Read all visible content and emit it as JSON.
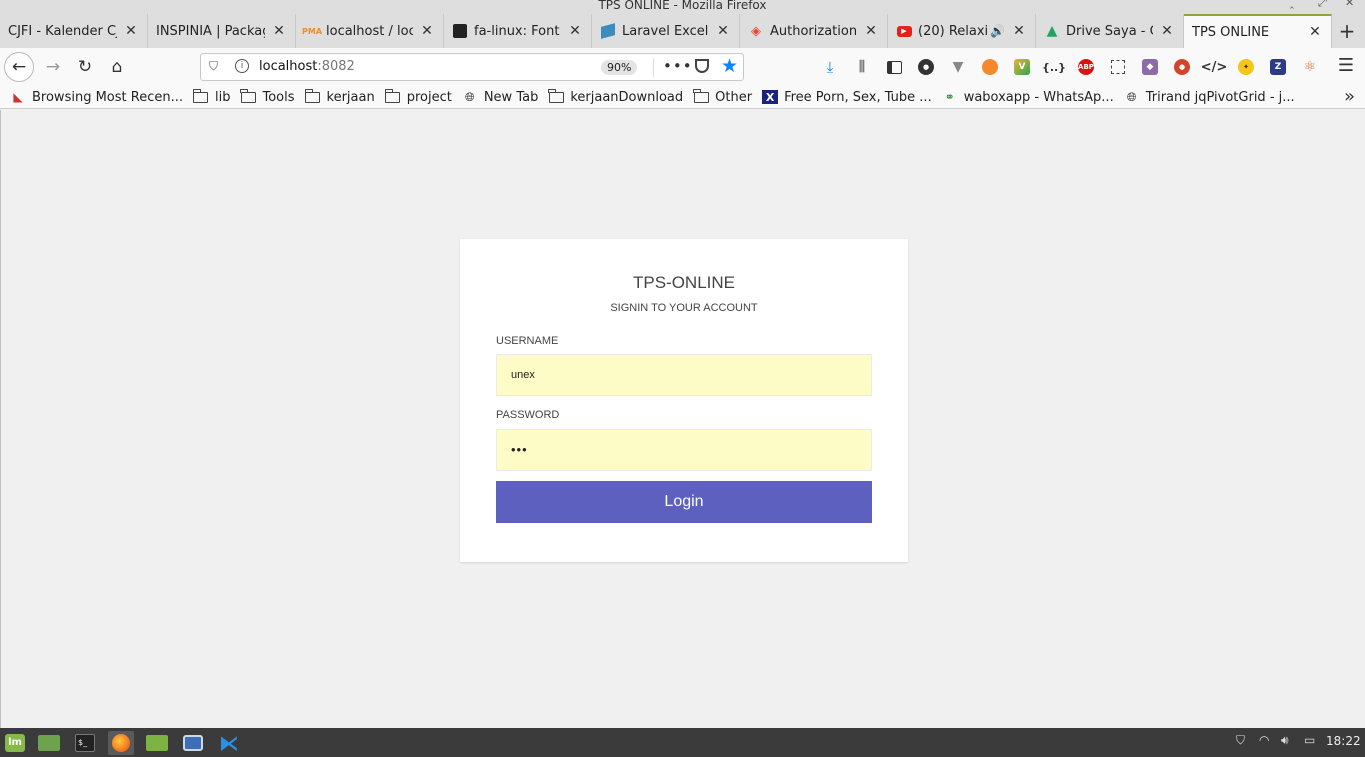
{
  "window": {
    "title": "TPS ONLINE - Mozilla Firefox"
  },
  "tabs": [
    {
      "title": "CJFI - Kalender CJ",
      "icon": "calendar-icon",
      "color": "#d44"
    },
    {
      "title": "INSPINIA | Packag",
      "icon": "",
      "color": ""
    },
    {
      "title": "localhost / loca",
      "icon": "phpmyadmin-icon",
      "color": "#e98d2f"
    },
    {
      "title": "fa-linux: Font A",
      "icon": "fontawesome-icon",
      "color": "#222"
    },
    {
      "title": "Laravel Excel |",
      "icon": "laravel-excel-icon",
      "color": "#3c8dbc"
    },
    {
      "title": "Authorization",
      "icon": "laravel-icon",
      "color": "#e74430"
    },
    {
      "title": "(20) Relaxin",
      "icon": "youtube-icon",
      "color": "#e62117"
    },
    {
      "title": "Drive Saya - Go",
      "icon": "google-drive-icon",
      "color": "#1fa463"
    },
    {
      "title": "TPS ONLINE",
      "icon": "",
      "color": ""
    }
  ],
  "urlbar": {
    "host": "localhost",
    "port": ":8082",
    "zoom": "90%"
  },
  "bookmarks": [
    {
      "label": "Browsing Most Recen...",
      "icon": "recent-icon"
    },
    {
      "label": "lib",
      "icon": "folder-icon"
    },
    {
      "label": "Tools",
      "icon": "folder-icon"
    },
    {
      "label": "kerjaan",
      "icon": "folder-icon"
    },
    {
      "label": "project",
      "icon": "folder-icon"
    },
    {
      "label": "New Tab",
      "icon": "globe-icon"
    },
    {
      "label": "kerjaanDownload",
      "icon": "folder-icon"
    },
    {
      "label": "Other",
      "icon": "folder-icon"
    },
    {
      "label": "Free Porn, Sex, Tube ...",
      "icon": "x-site-icon"
    },
    {
      "label": "waboxapp - WhatsAp...",
      "icon": "waboxapp-icon"
    },
    {
      "label": "Trirand jqPivotGrid - j...",
      "icon": "globe-icon"
    }
  ],
  "login": {
    "title": "TPS-ONLINE",
    "subtitle": "SIGNIN TO YOUR ACCOUNT",
    "username_label": "USERNAME",
    "username_value": "unex",
    "password_label": "PASSWORD",
    "password_value": "•••",
    "button_label": "Login",
    "accent_color": "#5d60bf",
    "autofill_color": "#fdfcc6"
  },
  "taskbar": {
    "clock": "18:22"
  }
}
